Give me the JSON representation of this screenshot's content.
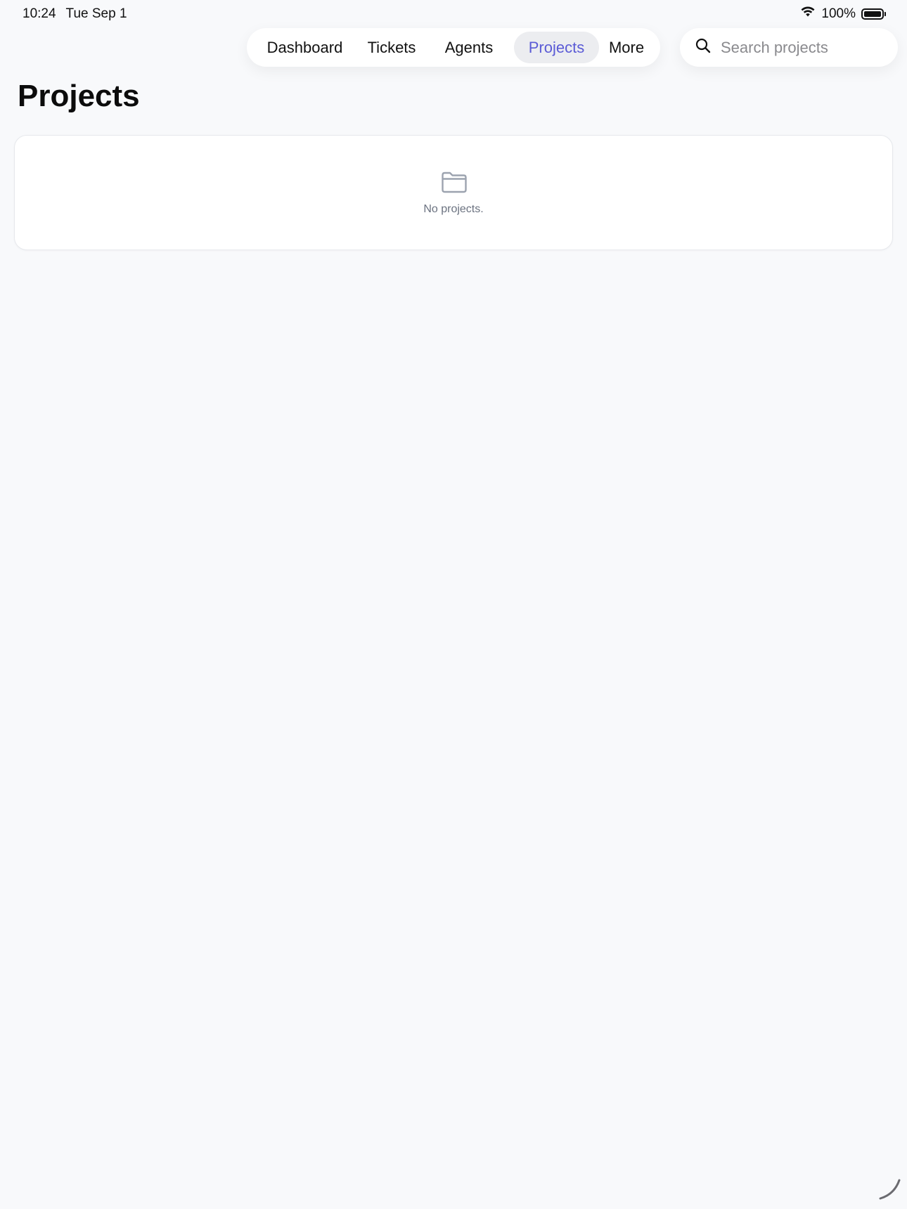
{
  "status_bar": {
    "time": "10:24",
    "date": "Tue Sep 1",
    "battery": "100%"
  },
  "nav": {
    "items": [
      {
        "label": "Dashboard"
      },
      {
        "label": "Tickets"
      },
      {
        "label": "Agents"
      },
      {
        "label": "Projects",
        "active": true
      },
      {
        "label": "More"
      }
    ]
  },
  "search": {
    "placeholder": "Search projects",
    "value": ""
  },
  "page": {
    "title": "Projects",
    "empty_state": "No projects."
  },
  "colors": {
    "accent": "#5b5bd6",
    "background": "#f8f9fb"
  }
}
